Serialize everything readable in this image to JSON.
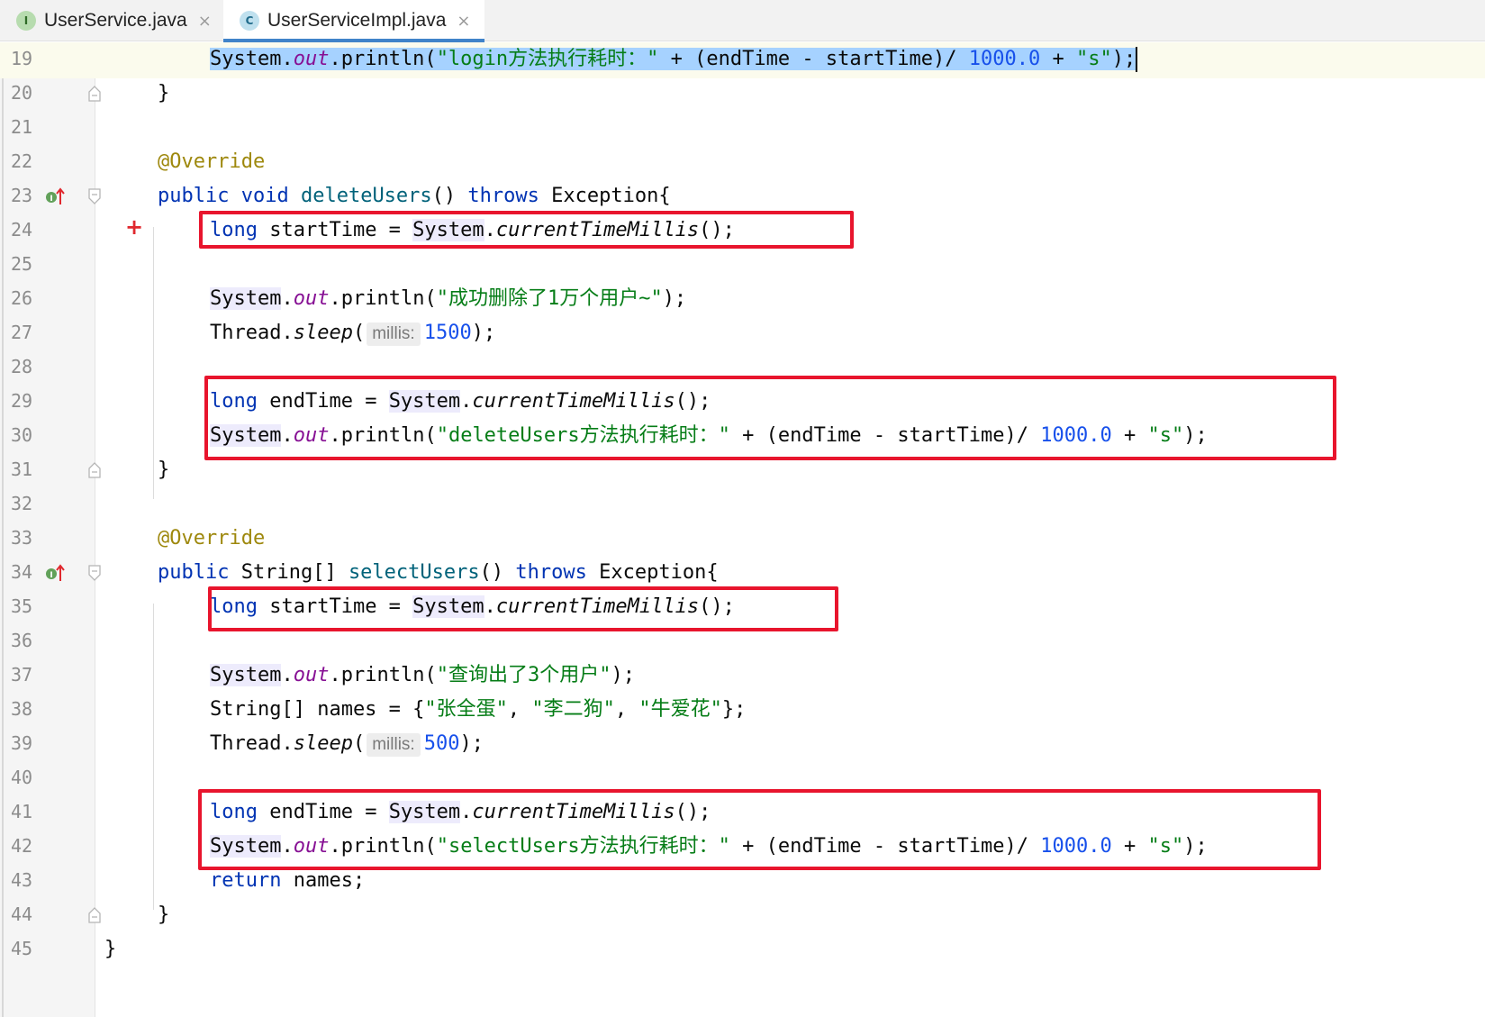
{
  "tabs": [
    {
      "label": "UserService.java",
      "icon": "interface-icon",
      "icon_letter": "I",
      "close": "×",
      "active": false
    },
    {
      "label": "UserServiceImpl.java",
      "icon": "class-icon",
      "icon_letter": "C",
      "close": "×",
      "active": true
    }
  ],
  "editor": {
    "line_numbers": [
      "19",
      "20",
      "21",
      "22",
      "23",
      "24",
      "25",
      "26",
      "27",
      "28",
      "29",
      "30",
      "31",
      "32",
      "33",
      "34",
      "35",
      "36",
      "37",
      "38",
      "39",
      "40",
      "41",
      "42",
      "43",
      "44",
      "45"
    ],
    "code": {
      "l19": {
        "pre1": "System.",
        "fld": "out",
        "pre2": ".println(",
        "str": "\"login方法执行耗时：\"",
        "mid": " + (endTime - startTime)/ ",
        "num": "1000.0",
        "mid2": " + ",
        "str2": "\"s\"",
        "end": ");"
      },
      "l20": "}",
      "l22": "@Override",
      "l23": {
        "kw1": "public",
        "kw2": "void",
        "meth": "deleteUsers",
        "mid": "() ",
        "kw3": "throws",
        "rest": " Exception{"
      },
      "l24": {
        "kw": "long",
        "a": " startTime = ",
        "cls": "System",
        "dot": ".",
        "stat": "currentTimeMillis",
        "end": "();"
      },
      "l26": {
        "cls": "System",
        "dot": ".",
        "fld": "out",
        "mid": ".println(",
        "str": "\"成功删除了1万个用户~\"",
        "end": ");"
      },
      "l27": {
        "cls": "Thread",
        "dot": ".",
        "stat": "sleep",
        "open": "(",
        "hint": "millis:",
        "num": "1500",
        "end": ");"
      },
      "l29": {
        "kw": "long",
        "a": " endTime = ",
        "cls": "System",
        "dot": ".",
        "stat": "currentTimeMillis",
        "end": "();"
      },
      "l30": {
        "cls": "System",
        "dot": ".",
        "fld": "out",
        "mid": ".println(",
        "str": "\"deleteUsers方法执行耗时：\"",
        "mid2": " + (endTime - startTime)/ ",
        "num": "1000.0",
        "mid3": " + ",
        "str2": "\"s\"",
        "end": ");"
      },
      "l31": "}",
      "l33": "@Override",
      "l34": {
        "kw1": "public",
        "typ": " String[] ",
        "meth": "selectUsers",
        "mid": "() ",
        "kw3": "throws",
        "rest": " Exception{"
      },
      "l35": {
        "kw": "long",
        "a": " startTime = ",
        "cls": "System",
        "dot": ".",
        "stat": "currentTimeMillis",
        "end": "();"
      },
      "l37": {
        "cls": "System",
        "dot": ".",
        "fld": "out",
        "mid": ".println(",
        "str": "\"查询出了3个用户\"",
        "end": ");"
      },
      "l38": {
        "a": "String[] names = {",
        "s1": "\"张全蛋\"",
        "c1": ", ",
        "s2": "\"李二狗\"",
        "c2": ", ",
        "s3": "\"牛爱花\"",
        "end": "};"
      },
      "l39": {
        "cls": "Thread",
        "dot": ".",
        "stat": "sleep",
        "open": "(",
        "hint": "millis:",
        "num": "500",
        "end": ");"
      },
      "l41": {
        "kw": "long",
        "a": " endTime = ",
        "cls": "System",
        "dot": ".",
        "stat": "currentTimeMillis",
        "end": "();"
      },
      "l42": {
        "cls": "System",
        "dot": ".",
        "fld": "out",
        "mid": ".println(",
        "str": "\"selectUsers方法执行耗时：\"",
        "mid2": " + (endTime - startTime)/ ",
        "num": "1000.0",
        "mid3": " + ",
        "str2": "\"s\"",
        "end": ");"
      },
      "l43": {
        "kw": "return",
        "rest": " names;"
      },
      "l44": "}",
      "l45": "}"
    },
    "gutter_marks": {
      "plus": "+"
    }
  },
  "colors": {
    "keyword": "#0033b3",
    "annotation": "#9e880d",
    "string": "#067d17",
    "number": "#1750eb",
    "field": "#871094",
    "method": "#00627a",
    "selection": "#a6d2ff",
    "annotation_box": "#e8152d",
    "active_tab_underline": "#4083c9"
  }
}
